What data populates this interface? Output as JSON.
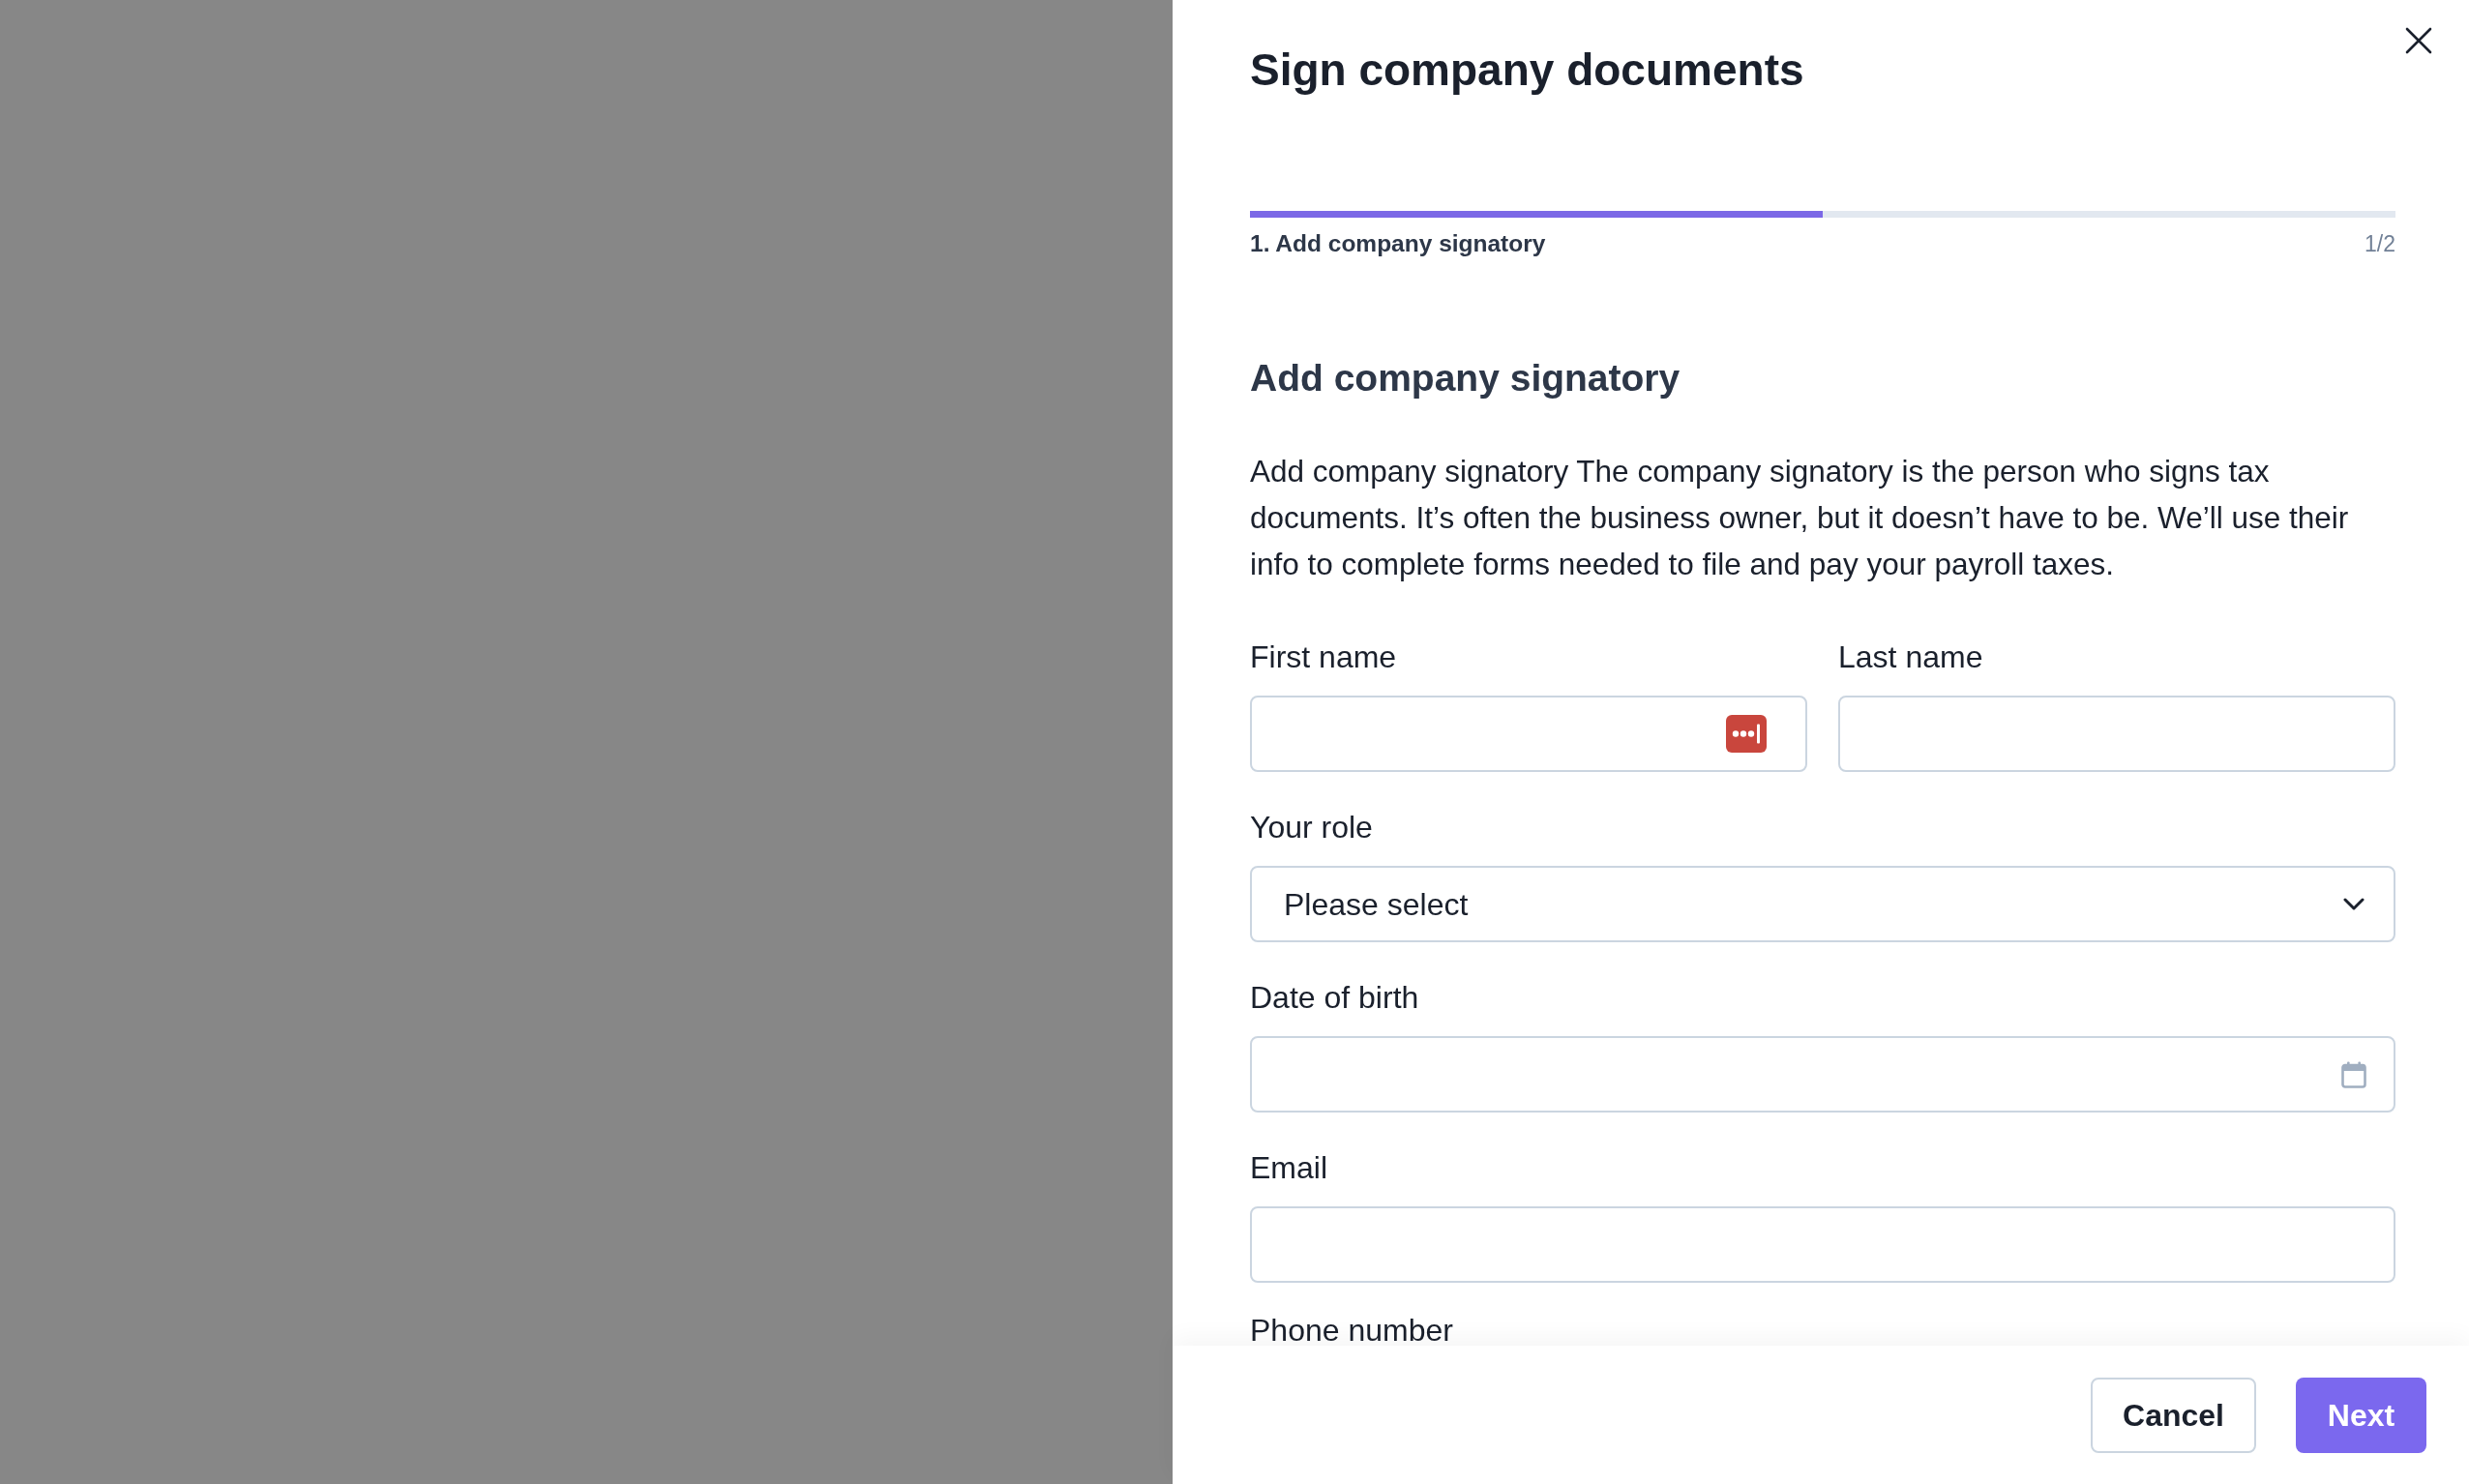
{
  "drawer": {
    "title": "Sign company documents",
    "progress": {
      "level": 0.5,
      "step_label": "1. Add company signatory",
      "step_count": "1/2"
    },
    "section": {
      "heading": "Add company signatory",
      "description": "Add company signatory The company signatory is the person who signs tax documents. It’s often the business owner, but it doesn’t have to be. We’ll use their info to complete forms needed to file and pay your payroll taxes."
    },
    "rows": [
      {
        "fields": [
          {
            "kind": "text",
            "label": "First name",
            "password_manager": true
          },
          {
            "kind": "text",
            "label": "Last name",
            "password_manager": false
          }
        ]
      },
      {
        "fields": [
          {
            "kind": "select",
            "label": "Your role",
            "placeholder": "Please select"
          }
        ]
      },
      {
        "fields": [
          {
            "kind": "date",
            "label": "Date of birth"
          }
        ]
      },
      {
        "fields": [
          {
            "kind": "text",
            "label": "Email",
            "password_manager": false
          }
        ]
      },
      {
        "fields": [
          {
            "kind": "label",
            "label": "Phone number"
          }
        ]
      }
    ],
    "footer": {
      "buttons": [
        {
          "kind": "secondary",
          "label": "Cancel"
        },
        {
          "kind": "primary",
          "label": "Next"
        }
      ]
    }
  }
}
